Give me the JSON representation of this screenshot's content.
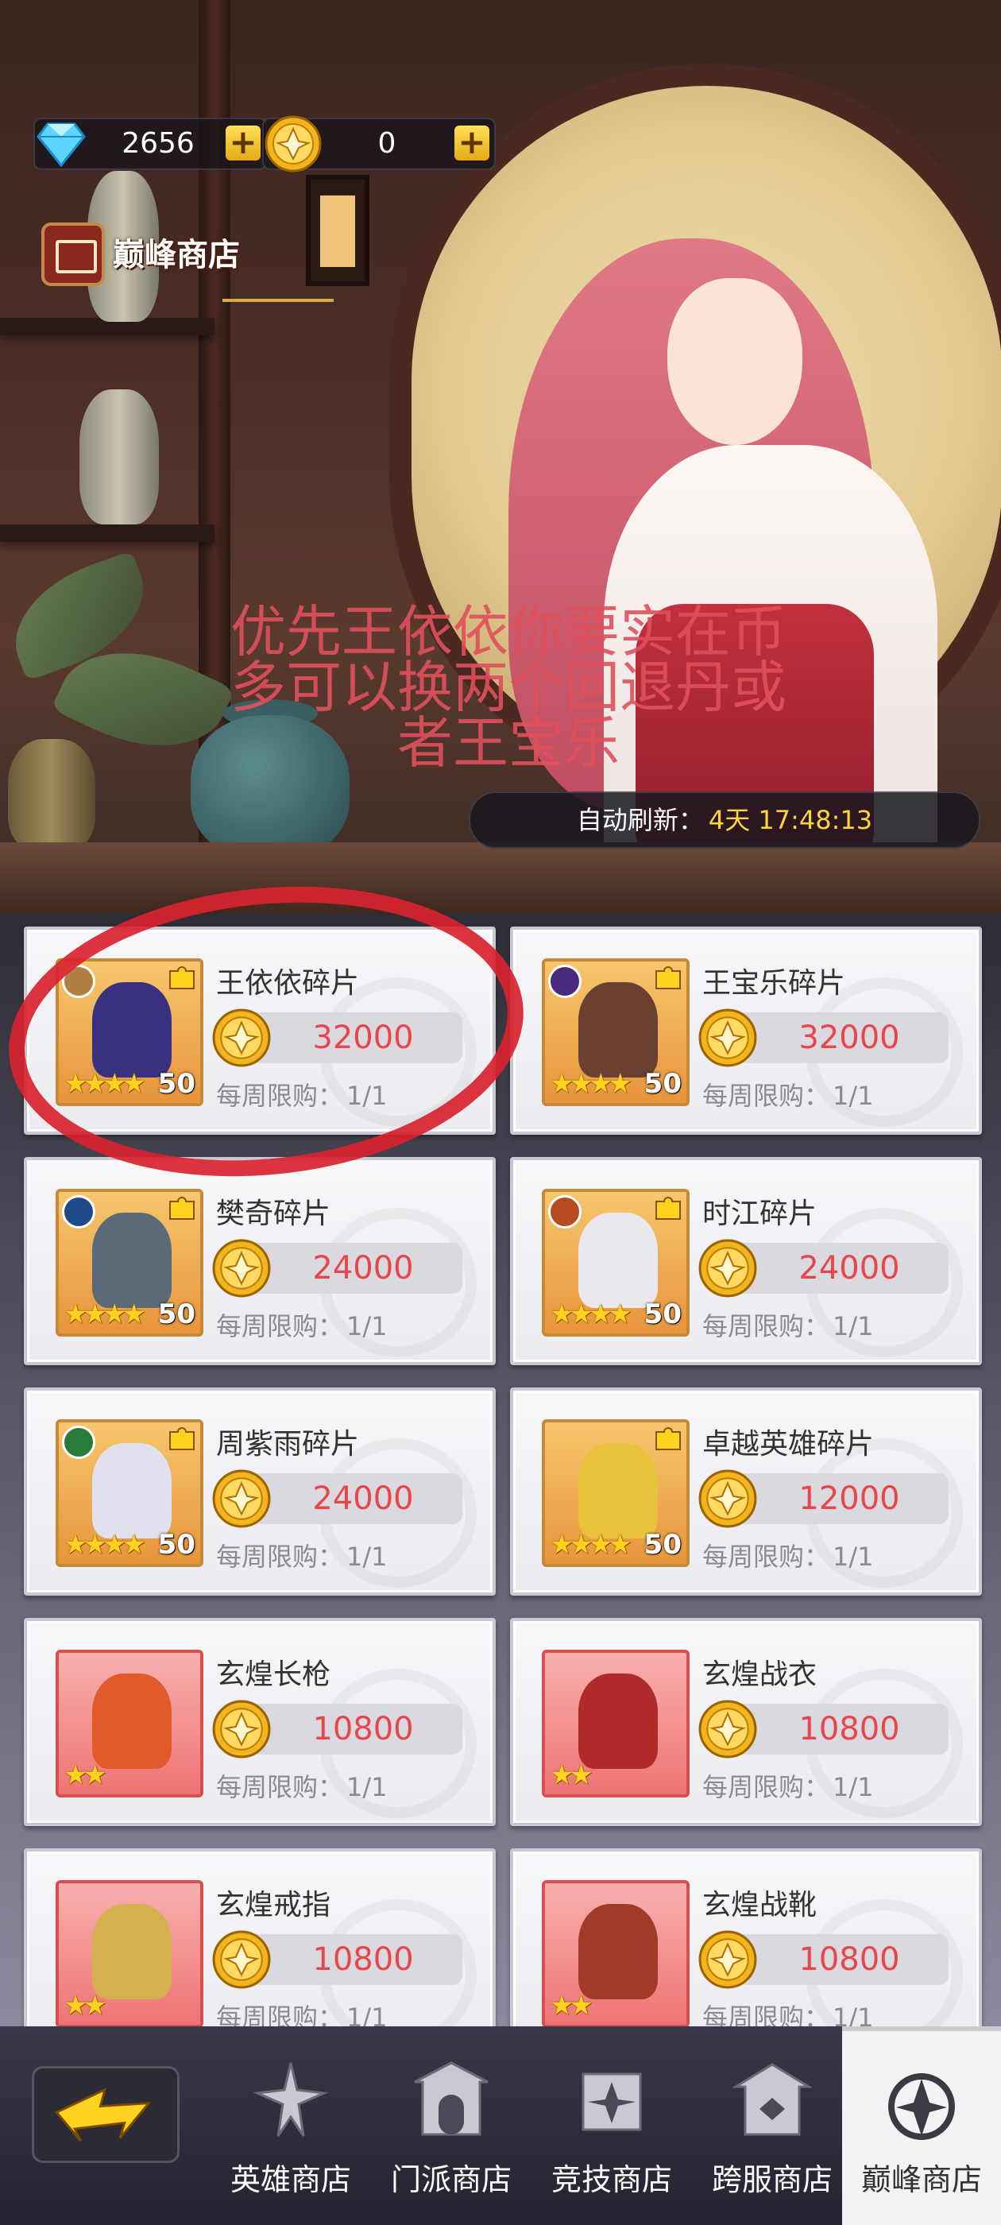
{
  "currency": {
    "gems": {
      "icon": "diamond-icon",
      "amount": "2656"
    },
    "coins": {
      "icon": "peak-coin-icon",
      "amount": "0"
    }
  },
  "shop": {
    "title": "巅峰商店"
  },
  "overlay_note": "优先王依依你要实在币多可以换两个回退丹或者王宝乐",
  "refresh": {
    "label": "自动刷新：",
    "time": "4天 17:48:13"
  },
  "items": [
    {
      "name": "王依依碎片",
      "price": "32000",
      "limit_label": "每周限购：",
      "limit_value": "1/1",
      "level": "50",
      "stars": "★★★★",
      "faction_color": "#b08040"
    },
    {
      "name": "王宝乐碎片",
      "price": "32000",
      "limit_label": "每周限购：",
      "limit_value": "1/1",
      "level": "50",
      "stars": "★★★★",
      "faction_color": "#4a2a7a"
    },
    {
      "name": "樊奇碎片",
      "price": "24000",
      "limit_label": "每周限购：",
      "limit_value": "1/1",
      "level": "50",
      "stars": "★★★★",
      "faction_color": "#1e4a8a"
    },
    {
      "name": "时江碎片",
      "price": "24000",
      "limit_label": "每周限购：",
      "limit_value": "1/1",
      "level": "50",
      "stars": "★★★★",
      "faction_color": "#b84a20"
    },
    {
      "name": "周紫雨碎片",
      "price": "24000",
      "limit_label": "每周限购：",
      "limit_value": "1/1",
      "level": "50",
      "stars": "★★★★",
      "faction_color": "#2a7a3a"
    },
    {
      "name": "卓越英雄碎片",
      "price": "12000",
      "limit_label": "每周限购：",
      "limit_value": "1/1",
      "level": "50",
      "stars": "★★★★"
    },
    {
      "name": "玄煌长枪",
      "price": "10800",
      "limit_label": "每周限购：",
      "limit_value": "1/1",
      "stars": "★★"
    },
    {
      "name": "玄煌战衣",
      "price": "10800",
      "limit_label": "每周限购：",
      "limit_value": "1/1",
      "stars": "★★"
    },
    {
      "name": "玄煌戒指",
      "price": "10800",
      "limit_label": "每周限购：",
      "limit_value": "1/1",
      "stars": "★★"
    },
    {
      "name": "玄煌战靴",
      "price": "10800",
      "limit_label": "每周限购：",
      "limit_value": "1/1",
      "stars": "★★"
    }
  ],
  "nav": {
    "back_icon": "lightning-back-icon",
    "tabs": [
      {
        "label": "英雄商店",
        "icon": "hero-shop-icon"
      },
      {
        "label": "门派商店",
        "icon": "sect-shop-icon"
      },
      {
        "label": "竞技商店",
        "icon": "arena-shop-icon"
      },
      {
        "label": "跨服商店",
        "icon": "cross-server-shop-icon"
      },
      {
        "label": "巅峰商店",
        "icon": "peak-shop-icon",
        "active": true
      }
    ]
  },
  "colors": {
    "price": "#e8464a",
    "refresh_time": "#ffd43b",
    "annotation": "#d8232f"
  }
}
